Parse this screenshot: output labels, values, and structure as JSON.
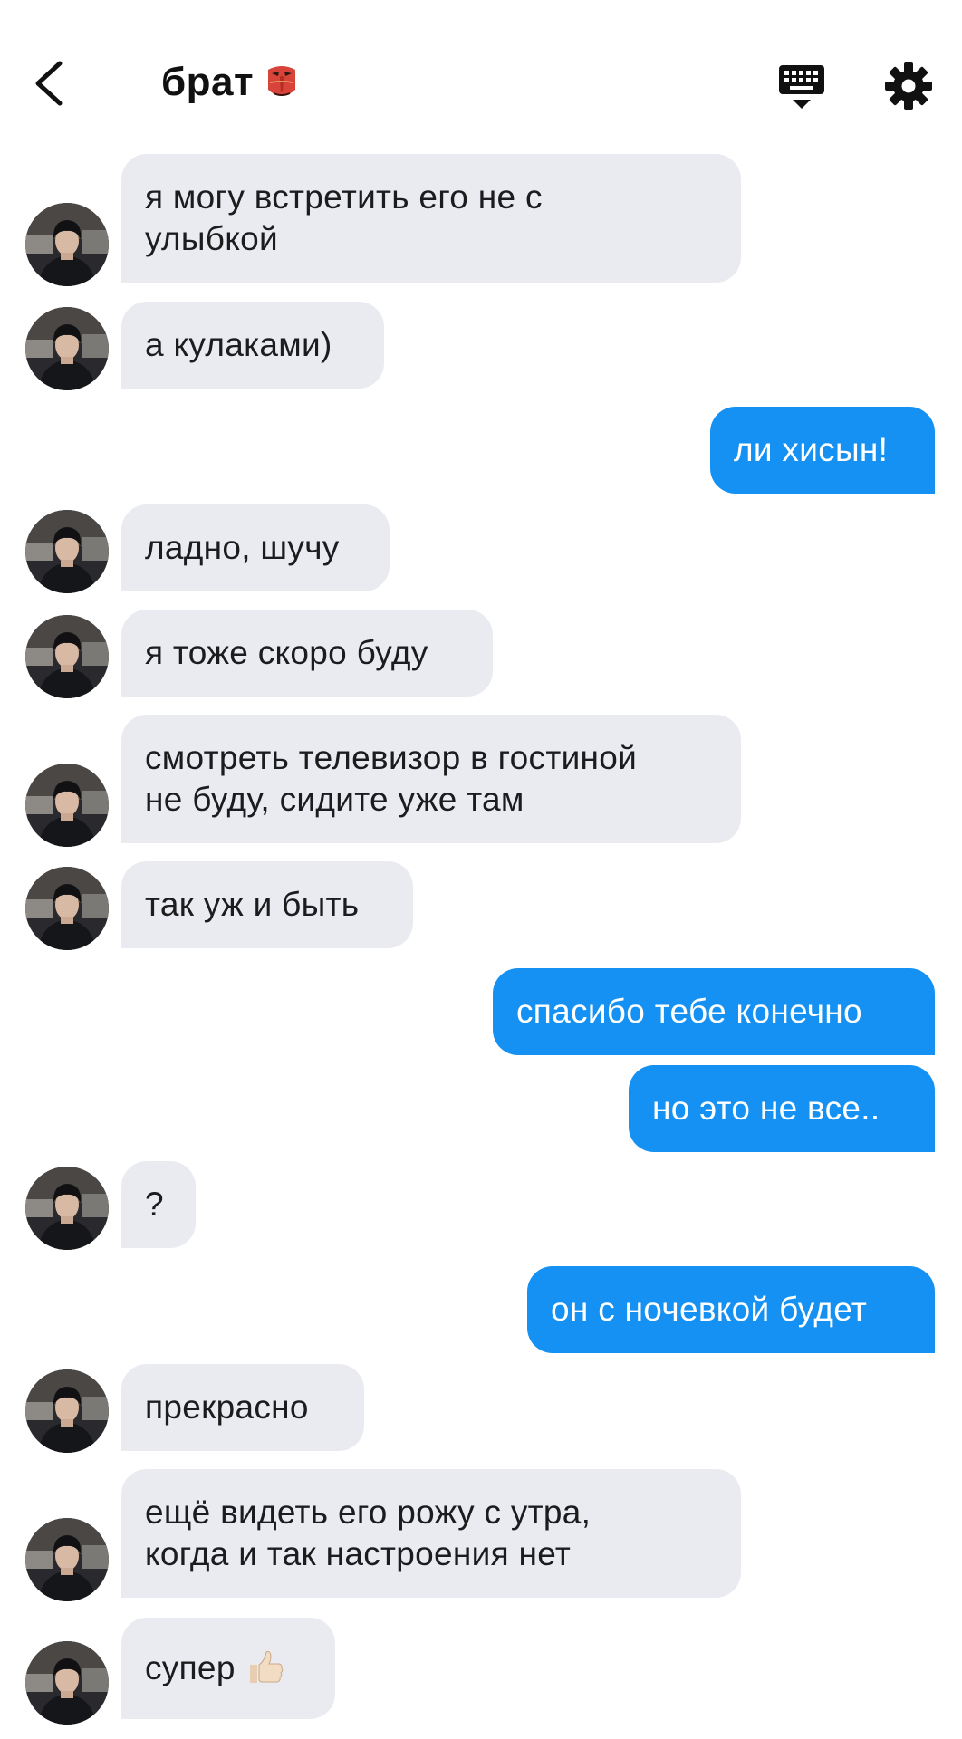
{
  "header": {
    "title": "брат",
    "title_emoji": "tengu-mask-emoji",
    "back_icon": "chevron-left-icon",
    "keyboard_icon": "keyboard-hide-icon",
    "settings_icon": "gear-icon"
  },
  "colors": {
    "incoming_bubble": "#e9ebf1",
    "outgoing_bubble": "#1491f2",
    "incoming_text": "#1c1c1e",
    "outgoing_text": "#ffffff"
  },
  "messages": [
    {
      "from": "contact",
      "lines": [
        "я могу встретить его не с",
        "улыбкой"
      ]
    },
    {
      "from": "contact",
      "lines": [
        "а кулаками)"
      ]
    },
    {
      "from": "me",
      "lines": [
        "ли хисын!"
      ]
    },
    {
      "from": "contact",
      "lines": [
        "ладно, шучу"
      ]
    },
    {
      "from": "contact",
      "lines": [
        "я тоже скоро буду"
      ]
    },
    {
      "from": "contact",
      "lines": [
        "смотреть телевизор в гостиной",
        "не буду, сидите уже там"
      ]
    },
    {
      "from": "contact",
      "lines": [
        "так уж и быть"
      ]
    },
    {
      "from": "me",
      "lines": [
        "спасибо тебе конечно"
      ]
    },
    {
      "from": "me",
      "lines": [
        "но это не все.."
      ]
    },
    {
      "from": "contact",
      "lines": [
        "?"
      ]
    },
    {
      "from": "me",
      "lines": [
        "он с ночевкой будет"
      ]
    },
    {
      "from": "contact",
      "lines": [
        "прекрасно"
      ]
    },
    {
      "from": "contact",
      "lines": [
        "ещё видеть его рожу с утра,",
        "когда и так настроения нет"
      ]
    },
    {
      "from": "contact",
      "lines": [
        "супер"
      ],
      "emoji": "thumbs-up-emoji"
    }
  ]
}
